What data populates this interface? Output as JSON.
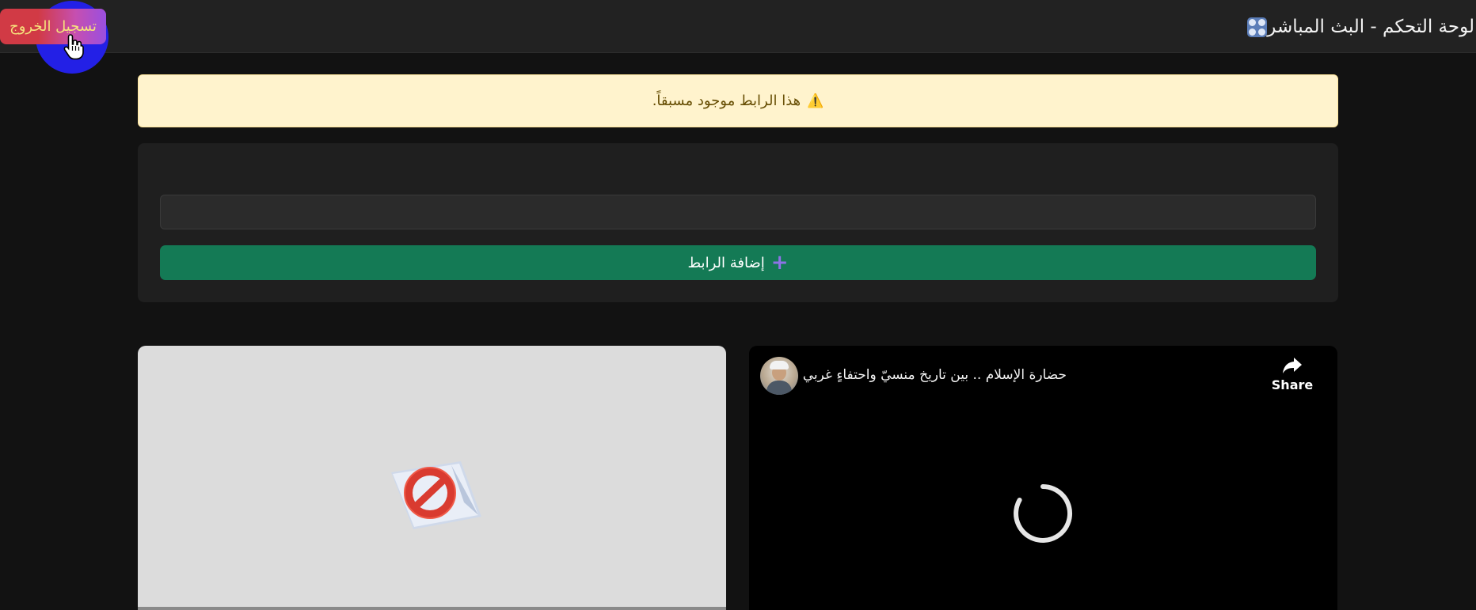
{
  "header": {
    "title": "لوحة التحكم - البث المباشر",
    "icon": "dashboard-grid-icon",
    "logout_label": "تسجيل الخروج"
  },
  "alert": {
    "icon": "warning-icon",
    "text": "هذا الرابط موجود مسبقاً."
  },
  "form": {
    "label": "",
    "url_placeholder": "",
    "add_button_label": "إضافة الرابط",
    "add_icon": "plus-icon"
  },
  "videos": [
    {
      "status": "blocked",
      "icon": "blocked-icon"
    },
    {
      "title": "حضارة الإسلام .. بين تاريخ منسيّ واحتفاءٍ غربي",
      "share_label": "Share",
      "status": "loading",
      "icons": [
        "channel-avatar",
        "share-icon",
        "loading-spinner-icon"
      ]
    }
  ],
  "colors": {
    "page_bg": "#121212",
    "topbar_bg": "#222222",
    "logout_bg": "#d13a45",
    "alert_bg": "#fff3cd",
    "alert_text": "#664d03",
    "add_button_bg": "#147a55",
    "cursor_highlight": "#2320e6"
  }
}
